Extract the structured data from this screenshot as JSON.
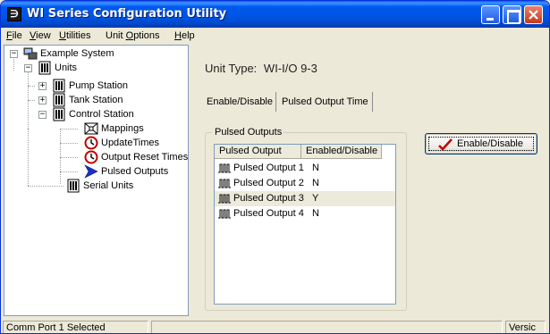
{
  "window": {
    "title": "WI Series Configuration Utility",
    "app_icon_glyph": "∋",
    "accent_color": "#0054e3"
  },
  "menu": [
    {
      "label": "File",
      "hotkey": "F"
    },
    {
      "label": "View",
      "hotkey": "V"
    },
    {
      "label": "Utilities",
      "hotkey": "U"
    },
    {
      "label": "Unit Options",
      "hotkey": "O"
    },
    {
      "label": "Help",
      "hotkey": "H"
    }
  ],
  "tree": {
    "root": {
      "label": "Example System",
      "icon": "system-icon",
      "expander": "−"
    },
    "units": {
      "label": "Units",
      "icon": "unit-icon",
      "expander": "−"
    },
    "pump_station": {
      "label": "Pump Station",
      "icon": "unit-icon",
      "expander": "+"
    },
    "tank_station": {
      "label": "Tank Station",
      "icon": "unit-icon",
      "expander": "+"
    },
    "control_station": {
      "label": "Control Station",
      "icon": "unit-icon",
      "expander": "−"
    },
    "mappings": {
      "label": "Mappings",
      "icon": "mapping-icon"
    },
    "update_times": {
      "label": "UpdateTimes",
      "icon": "clock-icon"
    },
    "output_reset_times": {
      "label": "Output Reset Times",
      "icon": "clock-icon"
    },
    "pulsed_outputs": {
      "label": "Pulsed Outputs",
      "icon": "arrow-icon"
    },
    "serial_units": {
      "label": "Serial Units",
      "icon": "unit-icon"
    }
  },
  "details": {
    "unit_type_label": "Unit Type:",
    "unit_type_value": "WI-I/O 9-3",
    "tabs": [
      {
        "label": "Enable/Disable",
        "active": true
      },
      {
        "label": "Pulsed Output Time",
        "active": false
      }
    ],
    "group_title": "Pulsed Outputs",
    "columns": [
      "Pulsed Output",
      "Enabled/Disable"
    ],
    "rows": [
      {
        "name": "Pulsed Output 1",
        "state": "N",
        "selected": false
      },
      {
        "name": "Pulsed Output 2",
        "state": "N",
        "selected": false
      },
      {
        "name": "Pulsed Output 3",
        "state": "Y",
        "selected": true
      },
      {
        "name": "Pulsed Output 4",
        "state": "N",
        "selected": false
      }
    ],
    "toggle_button_label": "Enable/Disable",
    "check_color": "#cc0000"
  },
  "status": {
    "left": "Comm Port 1 Selected",
    "middle": "",
    "right": "Versic"
  }
}
